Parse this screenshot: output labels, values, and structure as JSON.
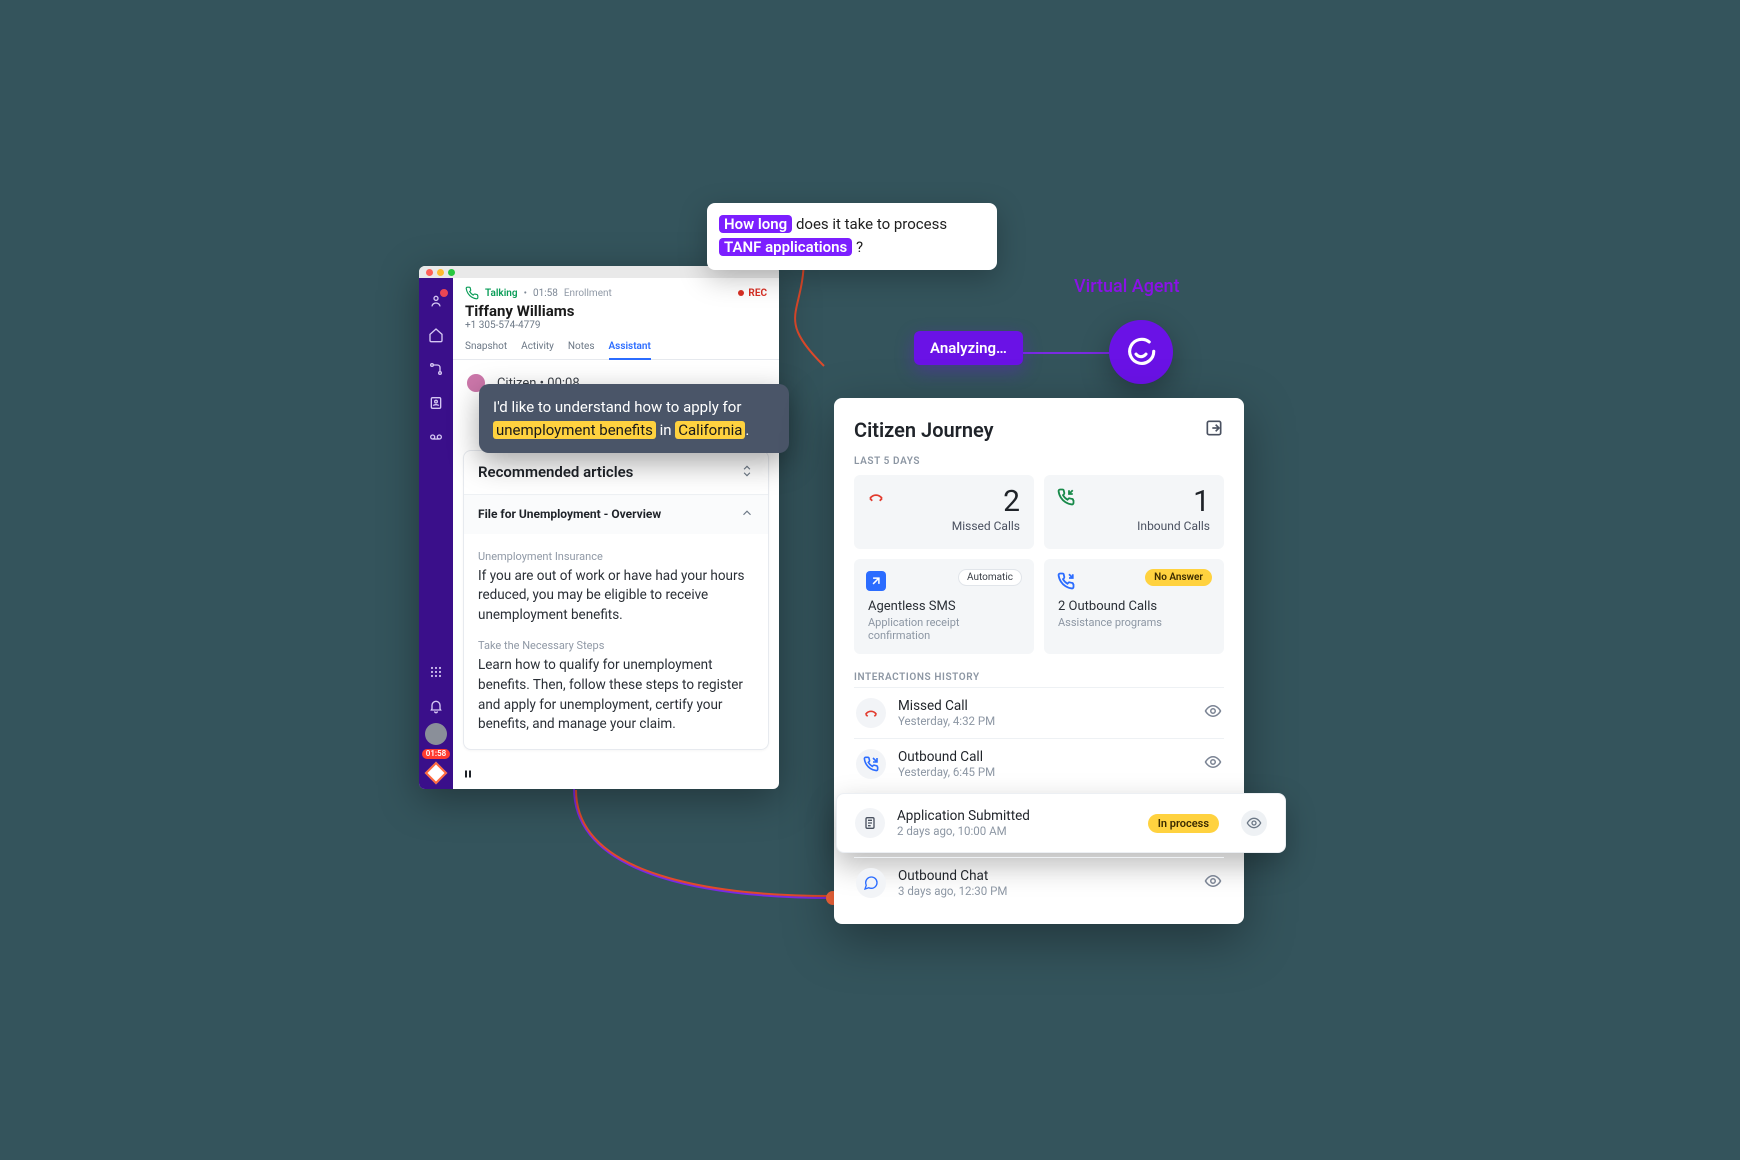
{
  "virtual_agent_label": "Virtual Agent",
  "analyzing": "Analyzing…",
  "question": {
    "pre": "",
    "hl1": "How long",
    "mid": " does it take to process ",
    "hl2": "TANF applications",
    "post": " ?"
  },
  "agent": {
    "titlebar": {},
    "status": {
      "state": "Talking",
      "duration": "01:58",
      "context": "Enrollment",
      "rec": "REC"
    },
    "contact": {
      "name": "Tiffany Williams",
      "phone": "+1 305-574-4779"
    },
    "tabs": [
      "Snapshot",
      "Activity",
      "Notes",
      "Assistant"
    ],
    "active_tab": "Assistant",
    "speaker_line": "Citizen • 00:08",
    "utterance": {
      "pre": "I'd like to understand how to apply for ",
      "hl1": "unemployment benefits",
      "mid": " in ",
      "hl2": "California",
      "post": "."
    },
    "recommended": {
      "heading": "Recommended articles",
      "item_title": "File for Unemployment - Overview",
      "sections": [
        {
          "eyebrow": "Unemployment Insurance",
          "copy": "If you are out of work or have had your hours reduced, you may be eligible to receive unemployment benefits."
        },
        {
          "eyebrow": "Take the Necessary Steps",
          "copy": "Learn how to qualify for unemployment benefits. Then, follow these steps to register and apply for unemployment, certify your benefits, and manage your claim."
        }
      ]
    },
    "sidebar_timer": "01:58"
  },
  "journey": {
    "title": "Citizen Journey",
    "last_label": "LAST 5 DAYS",
    "cards": {
      "missed": {
        "value": "2",
        "label": "Missed Calls"
      },
      "inbound": {
        "value": "1",
        "label": "Inbound Calls"
      },
      "sms": {
        "badge": "Automatic",
        "title": "Agentless SMS",
        "sub": "Application receipt confirmation"
      },
      "outbound": {
        "badge": "No Answer",
        "title": "2 Outbound Calls",
        "sub": "Assistance programs"
      }
    },
    "history_label": "INTERACTIONS HISTORY",
    "rows": [
      {
        "icon": "missed",
        "title": "Missed Call",
        "time": "Yesterday, 4:32 PM"
      },
      {
        "icon": "outcall",
        "title": "Outbound Call",
        "time": "Yesterday, 6:45 PM"
      },
      {
        "icon": "doc",
        "title": "Application Submitted",
        "time": "2 days ago, 10:00 AM",
        "pill": "In process",
        "pop": true
      },
      {
        "icon": "chat",
        "title": "Outbound Chat",
        "time": "3 days ago, 12:30 PM"
      }
    ]
  }
}
